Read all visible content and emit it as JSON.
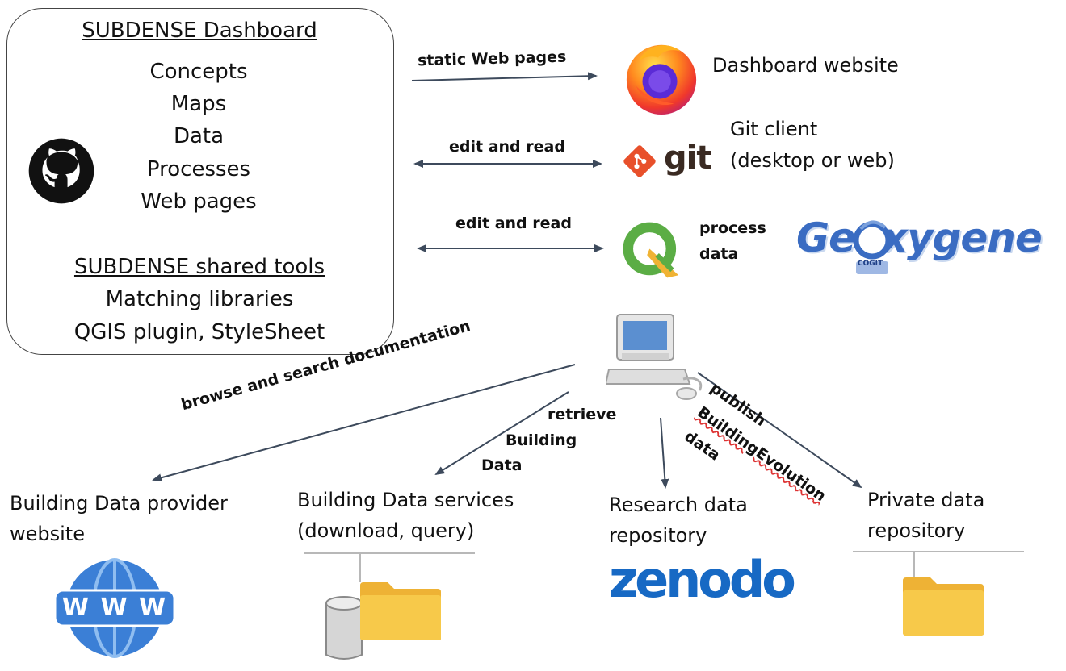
{
  "box": {
    "dashboard_title": "SUBDENSE Dashboard",
    "dashboard_items": [
      "Concepts",
      "Maps",
      "Data",
      "Processes",
      "Web pages"
    ],
    "tools_title": "SUBDENSE shared tools",
    "tools_items": [
      "Matching libraries",
      "QGIS plugin, StyleSheet"
    ]
  },
  "arrows": {
    "static_web": "static Web pages",
    "edit_read_git": "edit and read",
    "edit_read_qgis": "edit and read",
    "browse": "browse and search documentation",
    "retrieve": [
      "retrieve",
      "Building",
      "Data"
    ],
    "publish": [
      "publish",
      "BuildingEvolution",
      "data"
    ]
  },
  "tools": {
    "dashboard_website": "Dashboard website",
    "git_client": [
      "Git client",
      "(desktop or web)"
    ],
    "git_word": "git",
    "process_data": [
      "process",
      "data"
    ],
    "geoxygene": "Ge  xygene",
    "cogit": "COGIT"
  },
  "targets": {
    "provider": [
      "Building Data provider",
      "website"
    ],
    "www": "W W W",
    "services": [
      "Building Data services",
      "(download, query)"
    ],
    "research": [
      "Research data",
      "repository"
    ],
    "zenodo": "zenodo",
    "private": [
      "Private data",
      "repository"
    ]
  },
  "colors": {
    "arrow": "#3d4a5c",
    "globe": "#3b7fd6",
    "folder": "#f7c94a",
    "folder_tab": "#eeb235",
    "git": "#e8502b",
    "zenodo": "#1769c4",
    "geoxygene": "#3a6cc2",
    "qgis_green": "#5bad45",
    "qgis_orange": "#f0b334"
  }
}
